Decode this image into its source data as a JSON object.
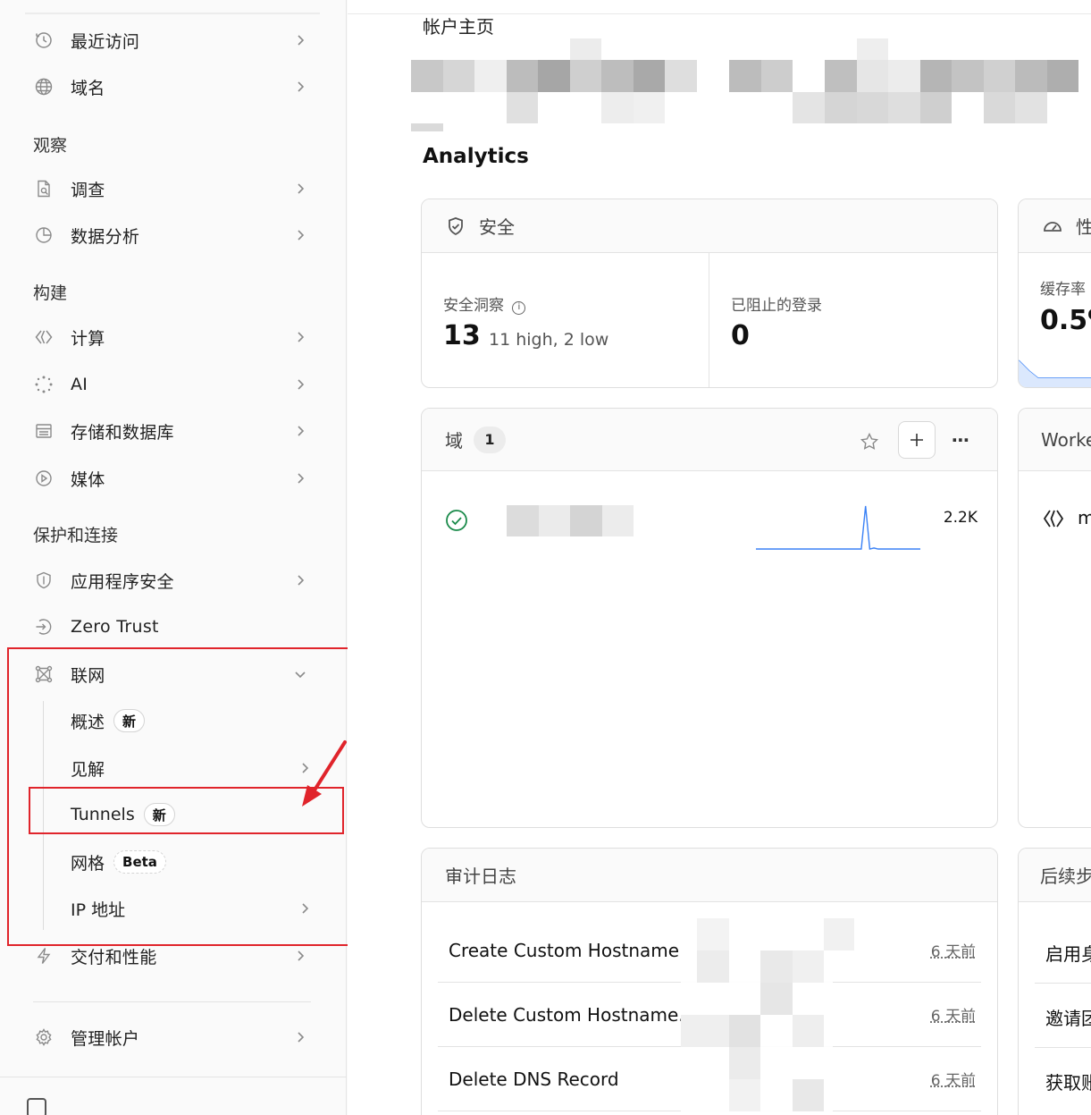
{
  "sidebar": {
    "items": {
      "recent": {
        "label": "最近访问"
      },
      "domains": {
        "label": "域名"
      },
      "investigate": {
        "label": "调查"
      },
      "analytics": {
        "label": "数据分析"
      },
      "compute": {
        "label": "计算"
      },
      "ai": {
        "label": "AI"
      },
      "storage": {
        "label": "存储和数据库"
      },
      "media": {
        "label": "媒体"
      },
      "appsec": {
        "label": "应用程序安全"
      },
      "zerotrust": {
        "label": "Zero Trust"
      },
      "networking": {
        "label": "联网"
      },
      "delivery": {
        "label": "交付和性能"
      },
      "manage": {
        "label": "管理帐户"
      }
    },
    "sections": {
      "observe": "观察",
      "build": "构建",
      "protect": "保护和连接"
    },
    "networking_sub": {
      "overview": {
        "label": "概述",
        "badge": "新"
      },
      "insights": {
        "label": "见解"
      },
      "tunnels": {
        "label": "Tunnels",
        "badge": "新"
      },
      "mesh": {
        "label": "网格",
        "badge": "Beta"
      },
      "ip": {
        "label": "IP 地址"
      }
    }
  },
  "main": {
    "account_title": "帐户主页",
    "analytics_heading": "Analytics",
    "security_card": {
      "title": "安全",
      "insights_label": "安全洞察",
      "insights_value": "13",
      "insights_detail": "11 high, 2 low",
      "blocked_label": "已阻止的登录",
      "blocked_value": "0"
    },
    "perf_card": {
      "title_partial": "性",
      "cache_label_partial": "缓存率",
      "cache_value_partial": "0.5%"
    },
    "domains_card": {
      "title": "域",
      "count": "1",
      "row_value": "2.2K",
      "sparkline": [
        0,
        0,
        0,
        0,
        0,
        0,
        0,
        0,
        0,
        0,
        0,
        0,
        0,
        0,
        0,
        0,
        0,
        0,
        0,
        0,
        0,
        0,
        0,
        0,
        0,
        0,
        45,
        0,
        1,
        0,
        0,
        0,
        0,
        0,
        0,
        0,
        0,
        0,
        0,
        0
      ]
    },
    "workers_card": {
      "title_partial": "Worke",
      "row_partial": "m"
    },
    "audit_card": {
      "title": "审计日志",
      "rows": [
        {
          "title": "Create Custom Hostname",
          "time": "6 天前"
        },
        {
          "title": "Delete Custom Hostname...",
          "time": "6 天前"
        },
        {
          "title": "Delete DNS Record",
          "time": "6 天前"
        }
      ]
    },
    "next_steps_card": {
      "title_partial": "后续步",
      "rows": [
        "启用身",
        "邀请团",
        "获取账"
      ]
    }
  },
  "colors": {
    "annotation_red": "#e0242b",
    "success_green": "#1a8a4a",
    "chart_blue": "#3b82f6"
  }
}
